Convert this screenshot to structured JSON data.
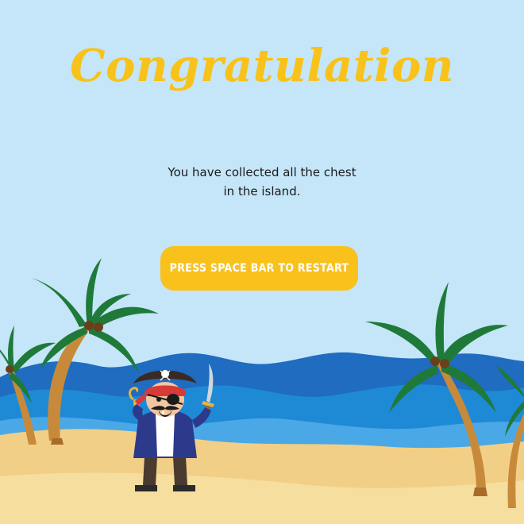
{
  "screen": {
    "title": "Congratulation",
    "message_line1": "You have collected all the chest",
    "message_line2": "in the island.",
    "restart_label": "PRESS SPACE BAR TO RESTART"
  },
  "colors": {
    "sky": "#c4e6f8",
    "title": "#f8c21a",
    "button": "#f9c11c",
    "sea_far": "#1f6cc0",
    "sea_near": "#1e8ad6",
    "sand": "#f4d58e",
    "palm_leaf": "#1f7a3a",
    "palm_trunk": "#c78a3a"
  },
  "icons": [
    "palm-tree-icon",
    "pirate-character-icon",
    "skull-icon",
    "sword-icon",
    "hook-icon"
  ]
}
